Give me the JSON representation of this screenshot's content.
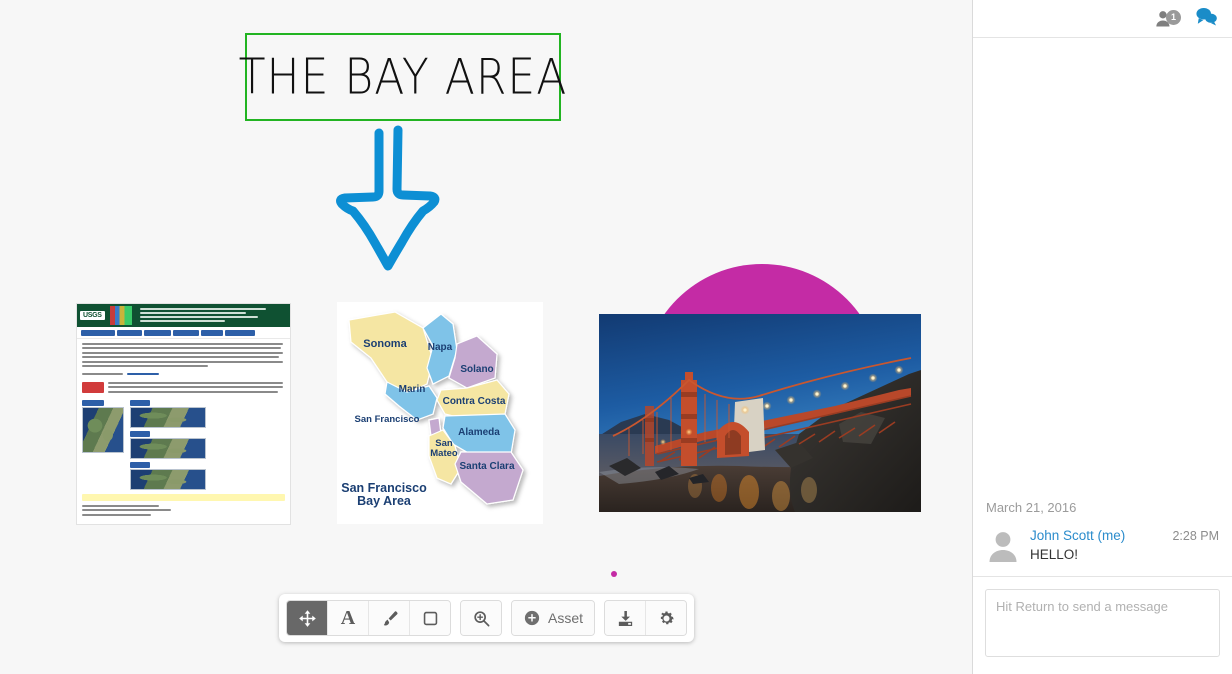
{
  "canvas": {
    "title_card": {
      "text": "THE BAY AREA",
      "border_color": "#22b422"
    },
    "arrow": {
      "name": "down-arrow",
      "color": "#0d8fd4"
    },
    "circle": {
      "name": "magenta-circle",
      "color": "#c42ba5"
    },
    "dot": {
      "name": "magenta-dot",
      "color": "#c42ba5"
    },
    "usgs_doc": {
      "name": "usgs-webpage-screenshot",
      "logo": "USGS",
      "header_color": "#0f5132"
    },
    "map": {
      "name": "san-francisco-bay-area-county-map",
      "caption_line1": "San Francisco",
      "caption_line2": "Bay Area",
      "counties": [
        {
          "label": "Sonoma",
          "color": "#f5e6a3"
        },
        {
          "label": "Napa",
          "color": "#7fc3e8"
        },
        {
          "label": "Solano",
          "color": "#c4a9cf"
        },
        {
          "label": "Marin",
          "color": "#7fc3e8"
        },
        {
          "label": "Contra Costa",
          "color": "#f5e6a3"
        },
        {
          "label": "San Francisco",
          "color": "#c4a9cf"
        },
        {
          "label": "Alameda",
          "color": "#7fc3e8"
        },
        {
          "label": "San Mateo",
          "color": "#f5e6a3"
        },
        {
          "label": "Santa Clara",
          "color": "#c4a9cf"
        }
      ],
      "label_color": "#1b3f73"
    },
    "photo": {
      "name": "golden-gate-bridge-photo"
    }
  },
  "toolbar": {
    "tools": [
      {
        "id": "move",
        "label": "Move",
        "icon": "move-icon",
        "active": true
      },
      {
        "id": "text",
        "label": "Text",
        "icon": "text-icon",
        "active": false
      },
      {
        "id": "brush",
        "label": "Brush",
        "icon": "brush-icon",
        "active": false
      },
      {
        "id": "shape",
        "label": "Shape",
        "icon": "square-icon",
        "active": false
      }
    ],
    "zoom": {
      "id": "zoom",
      "label": "Zoom",
      "icon": "zoom-in-icon"
    },
    "asset": {
      "id": "asset",
      "label": "Asset",
      "icon": "plus-circle-icon"
    },
    "download": {
      "id": "download",
      "label": "Download",
      "icon": "download-icon"
    },
    "settings": {
      "id": "settings",
      "label": "Settings",
      "icon": "gear-icon"
    }
  },
  "panel": {
    "header": {
      "people_icon": "people-icon",
      "people_count": "1",
      "chat_icon": "chat-bubble-icon"
    },
    "messages": [
      {
        "date": "March 21, 2016",
        "author": "John Scott (me)",
        "time": "2:28 PM",
        "text": "HELLO!",
        "avatar": "default-avatar-icon"
      }
    ],
    "composer": {
      "placeholder": "Hit Return to send a message",
      "value": ""
    }
  }
}
